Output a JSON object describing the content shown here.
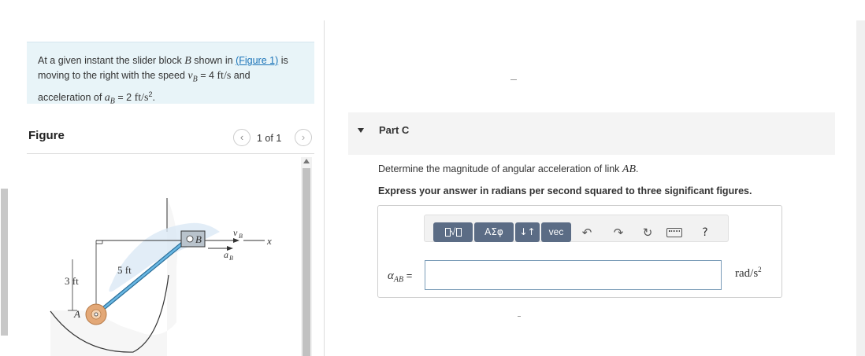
{
  "problem": {
    "line1_pre": "At a given instant the slider block ",
    "block": "B",
    "line1_mid": " shown in ",
    "figure_link": "(Figure 1)",
    "line1_post": " is",
    "line2_pre": "moving to the right with the speed ",
    "speed_sym": "v",
    "speed_sub": "B",
    "speed_eq": " = 4 ",
    "speed_unit": "ft/s",
    "line2_post": " and",
    "line3_pre": "acceleration of ",
    "acc_sym": "a",
    "acc_sub": "B",
    "acc_eq": " = 2 ",
    "acc_unit": "ft/s",
    "acc_exp": "2",
    "line3_post": "."
  },
  "figure": {
    "title": "Figure",
    "page_count": "1 of 1",
    "prev_icon": "chevron-left-icon",
    "next_icon": "chevron-right-icon",
    "labels": {
      "vb": "v",
      "vb_sub": "B",
      "ab": "a",
      "ab_sub": "B",
      "x": "x",
      "b": "B",
      "a": "A",
      "len_5": "5 ft",
      "len_3": "3 ft"
    }
  },
  "part": {
    "title": "Part C",
    "question_pre": "Determine the magnitude of angular acceleration of link ",
    "question_link": "AB",
    "question_post": ".",
    "instruction": "Express your answer in radians per second squared to three significant figures."
  },
  "toolbar": {
    "greek": "ΑΣφ",
    "arrows": "↓↑",
    "vec": "vec",
    "help": "?",
    "icons": [
      "sqrt-template-icon",
      "undo-icon",
      "redo-icon",
      "reset-icon",
      "keyboard-icon"
    ]
  },
  "answer": {
    "label_sym": "α",
    "label_sub": "AB",
    "label_eq": " =",
    "value": "",
    "unit": "rad/s",
    "unit_exp": "2"
  },
  "colors": {
    "problem_bg": "#e8f4f8",
    "link": "#1a73b8",
    "toolbar_button": "#5b6c85",
    "input_border": "#7a9cb8",
    "rod": "#4a9fd0"
  }
}
